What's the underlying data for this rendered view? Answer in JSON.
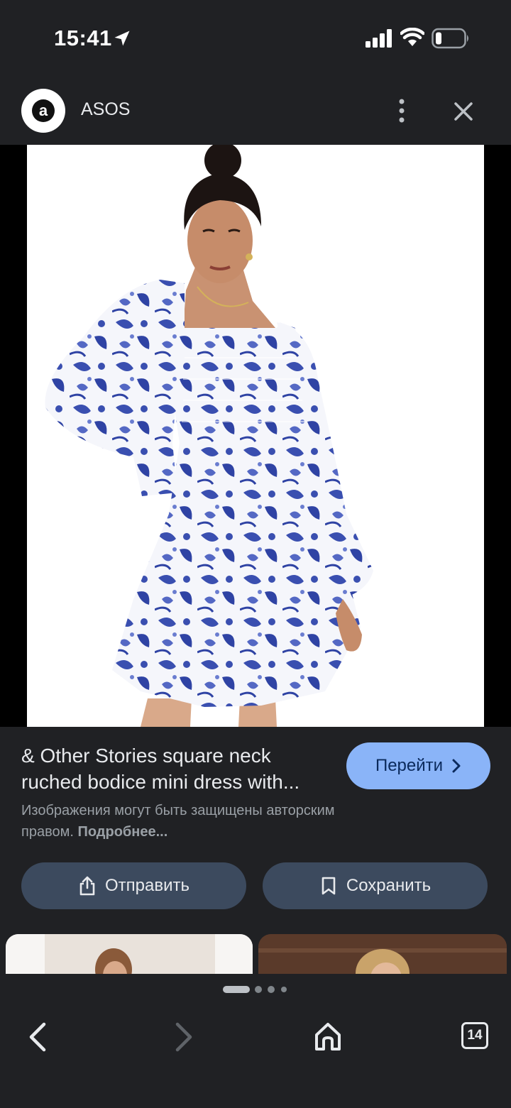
{
  "status_bar": {
    "time": "15:41",
    "icons": [
      "location-arrow-icon",
      "signal-bars-icon",
      "wifi-icon",
      "battery-low-icon"
    ]
  },
  "header": {
    "site_name": "ASOS",
    "logo_letter": "a",
    "icons": [
      "more-vertical-icon",
      "close-icon"
    ]
  },
  "result": {
    "title_line1": "& Other Stories square neck",
    "title_line2": "ruched bodice mini dress with...",
    "visit_label": "Перейти",
    "notice_text": "Изображения могут быть защищены авторским правом.",
    "notice_link": "Подробнее..."
  },
  "actions": {
    "share_label": "Отправить",
    "save_label": "Сохранить"
  },
  "toolbar": {
    "tab_count": "14",
    "icons": [
      "back-icon",
      "forward-icon",
      "home-icon",
      "tabs-icon"
    ]
  },
  "colors": {
    "background": "#202124",
    "accent": "#8ab4f8",
    "action_button": "#3c4a5e",
    "dress_print": "#3a4fb0"
  }
}
